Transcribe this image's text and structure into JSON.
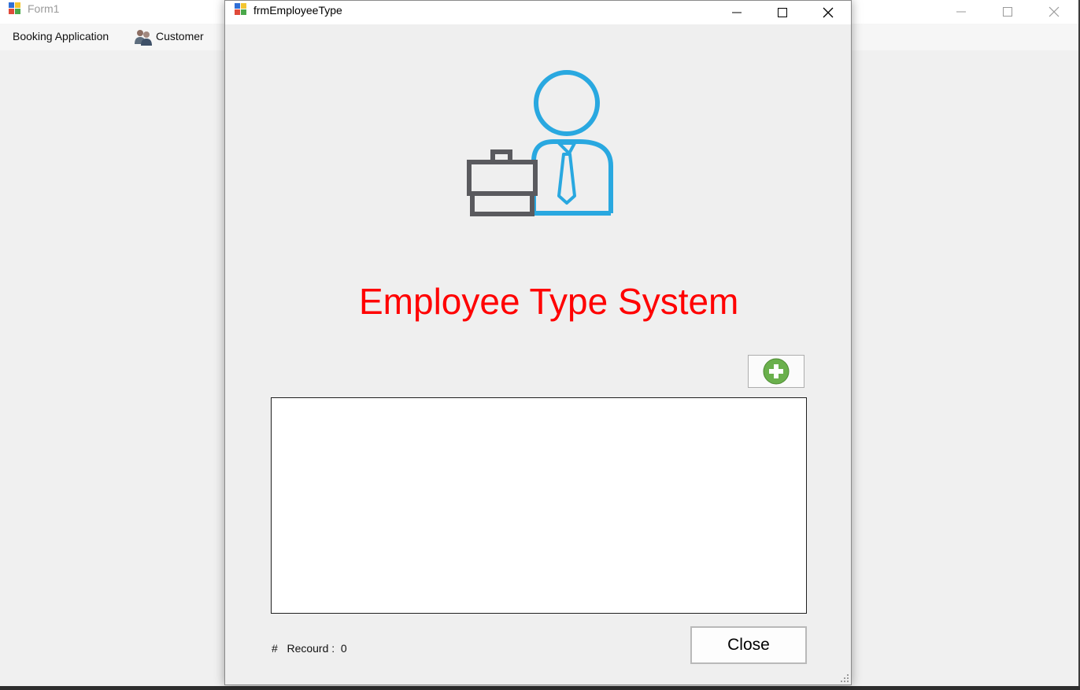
{
  "parent_window": {
    "title": "Form1",
    "menu": {
      "booking_application": "Booking Application",
      "customer": "Customer"
    }
  },
  "dialog": {
    "title": "frmEmployeeType",
    "heading": "Employee Type System",
    "record_label": "#   Recourd :  0",
    "close_label": "Close"
  },
  "icons": {
    "app": "app-window-icon",
    "customer": "users-icon",
    "hero": "employee-with-briefcase-icon",
    "add": "green-plus-circle-icon"
  },
  "colors": {
    "heading": "#ff0000",
    "hero_person": "#29a8e0",
    "hero_briefcase": "#5a5a5e",
    "add_button": "#6ab04c"
  }
}
